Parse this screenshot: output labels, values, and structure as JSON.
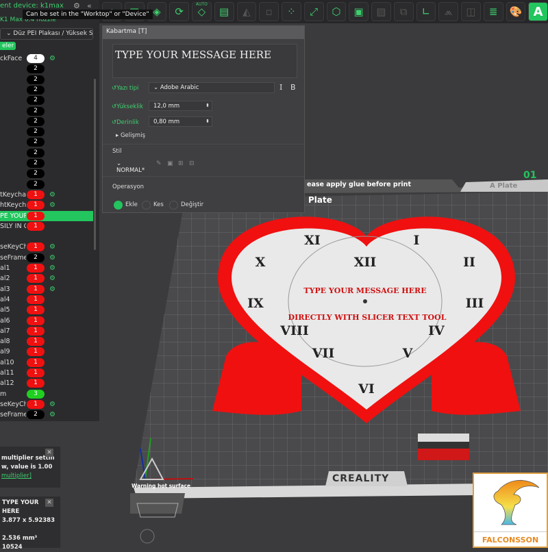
{
  "left_panel": {
    "device_label": "ent device: k1max",
    "collapse": "«",
    "tooltip": "Can be set in the \"Worktop\" or \"Device\"",
    "printer": "K1 Max 0.4 nozzle",
    "plate_type": "Düz PEI Plakası / Yüksek S",
    "tag": "eler",
    "objects": [
      {
        "name": "ckFace",
        "count": "4",
        "color": "white",
        "gear": true
      },
      {
        "name": "",
        "count": "2",
        "color": "black"
      },
      {
        "name": "",
        "count": "2",
        "color": "black"
      },
      {
        "name": "",
        "count": "2",
        "color": "black"
      },
      {
        "name": "",
        "count": "2",
        "color": "black"
      },
      {
        "name": "",
        "count": "2",
        "color": "black"
      },
      {
        "name": "",
        "count": "2",
        "color": "black"
      },
      {
        "name": "",
        "count": "2",
        "color": "black"
      },
      {
        "name": "",
        "count": "2",
        "color": "black"
      },
      {
        "name": "",
        "count": "2",
        "color": "black"
      },
      {
        "name": "",
        "count": "2",
        "color": "black"
      },
      {
        "name": "",
        "count": "2",
        "color": "black"
      },
      {
        "name": "",
        "count": "2",
        "color": "black"
      },
      {
        "name": "tKeychain",
        "count": "1",
        "color": "red",
        "gear": true
      },
      {
        "name": "htKeycha",
        "count": "1",
        "color": "red",
        "gear": true
      },
      {
        "name": "PE YOUR I",
        "count": "1",
        "color": "red",
        "active": true
      },
      {
        "name": "SILY IN CF",
        "count": "1",
        "color": "red"
      },
      {
        "name": "",
        "count": "",
        "color": "none"
      },
      {
        "name": "seKeyCha",
        "count": "1",
        "color": "red",
        "gear": true
      },
      {
        "name": "seFrame",
        "count": "2",
        "color": "black",
        "gear": true
      },
      {
        "name": "al1",
        "count": "1",
        "color": "red",
        "gear": true
      },
      {
        "name": "al2",
        "count": "1",
        "color": "red",
        "gear": true
      },
      {
        "name": "al3",
        "count": "1",
        "color": "red",
        "gear": true
      },
      {
        "name": "al4",
        "count": "1",
        "color": "red"
      },
      {
        "name": "al5",
        "count": "1",
        "color": "red"
      },
      {
        "name": "al6",
        "count": "1",
        "color": "red"
      },
      {
        "name": "al7",
        "count": "1",
        "color": "red"
      },
      {
        "name": "al8",
        "count": "1",
        "color": "red"
      },
      {
        "name": "al9",
        "count": "1",
        "color": "red"
      },
      {
        "name": "al10",
        "count": "1",
        "color": "red"
      },
      {
        "name": "al11",
        "count": "1",
        "color": "red"
      },
      {
        "name": "al12",
        "count": "1",
        "color": "red"
      },
      {
        "name": "m",
        "count": "3",
        "color": "green"
      },
      {
        "name": "seKeyCha",
        "count": "1",
        "color": "red",
        "gear": true
      },
      {
        "name": "seFrame",
        "count": "2",
        "color": "black",
        "gear": true
      }
    ],
    "notice1": {
      "line1": "multiplier settin",
      "line2": "w, value is 1.00",
      "link": "multiplier]"
    },
    "notice2": {
      "line1": "TYPE YOUR",
      "line2": "HERE",
      "size": "3.877 x 5.92383",
      "volume": "2.536 mm³",
      "facets": "10524"
    }
  },
  "toolbar": {
    "icons": [
      "add-plate-icon",
      "calculator-icon",
      "arrange-icon",
      "rotate-icon",
      "auto-orient-icon",
      "layout-icon",
      "lay-on-face-icon",
      "split-icon",
      "support-icon",
      "scale-icon",
      "cube-icon",
      "box-icon",
      "cut-icon",
      "boolean-icon",
      "measure-icon",
      "paint-support-icon",
      "seam-icon",
      "layers-icon",
      "color-paint-icon",
      "text-icon"
    ],
    "auto_label": "AUTO",
    "text_icon": "A"
  },
  "emboss": {
    "title": "Kabartma [T]",
    "text": "TYPE YOUR MESSAGE HERE",
    "font_label": "Yazı tipi",
    "font": "Adobe Arabic",
    "italic": "I",
    "bold": "B",
    "height_label": "Yükseklik",
    "height": "12,0 mm",
    "depth_label": "Derinlik",
    "depth": "0,80 mm",
    "advanced": "Gelişmiş",
    "style_label": "Stil",
    "style": "NORMAL*",
    "operation_label": "Operasyon",
    "ops": [
      "Ekle",
      "Kes",
      "Değiştir"
    ]
  },
  "viewport": {
    "plate_number": "01",
    "glue_notice": "ease apply glue before print",
    "plate_tab": "A Plate",
    "plate_label": "Plate",
    "brand": "CREALITY",
    "warning": "Warning hot surface",
    "clock": {
      "numerals": [
        "XII",
        "I",
        "II",
        "III",
        "IV",
        "V",
        "VI",
        "VII",
        "VIII",
        "IX",
        "X",
        "XI"
      ],
      "line1": "TYPE YOUR MESSAGE HERE",
      "line2": "DIRECTLY WITH SLICER TEXT TOOL"
    },
    "logo": "FALCONSSON"
  },
  "colors": {
    "accent": "#22c55e",
    "red": "#f01010"
  }
}
